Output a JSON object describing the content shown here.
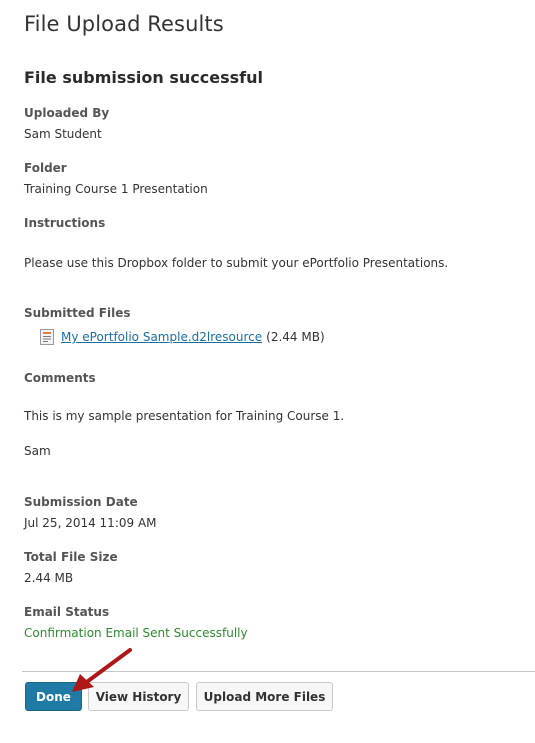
{
  "page": {
    "title": "File Upload Results",
    "heading": "File submission successful"
  },
  "details": {
    "uploaded_by_label": "Uploaded By",
    "uploaded_by_value": "Sam Student",
    "folder_label": "Folder",
    "folder_value": "Training Course 1 Presentation",
    "instructions_label": "Instructions",
    "instructions_value": "Please use this Dropbox folder to submit your ePortfolio Presentations.",
    "submitted_files_label": "Submitted Files",
    "file_name": "My ePortfolio Sample.d2lresource",
    "file_size": "(2.44 MB)",
    "file_icon": "file-icon",
    "comments_label": "Comments",
    "comment_line1": "This is my sample presentation for Training Course 1.",
    "comment_line2": "Sam",
    "submission_date_label": "Submission Date",
    "submission_date_value": "Jul 25, 2014 11:09 AM",
    "total_file_size_label": "Total File Size",
    "total_file_size_value": "2.44 MB",
    "email_status_label": "Email Status",
    "email_status_value": "Confirmation Email Sent Successfully"
  },
  "actions": {
    "done_label": "Done",
    "view_history_label": "View History",
    "upload_more_label": "Upload More Files"
  },
  "colors": {
    "primary_button": "#1f7aa6",
    "link": "#1a6fa3",
    "success_text": "#2e8b2e",
    "annotation_arrow": "#b01818"
  }
}
